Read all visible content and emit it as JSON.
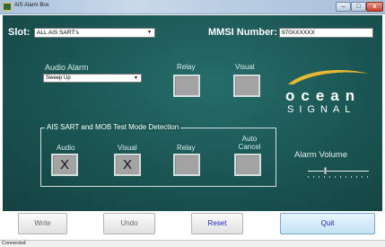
{
  "window": {
    "title": "AIS Alarm Box",
    "minimize_label": "–",
    "maximize_label": "□",
    "close_label": "x"
  },
  "header": {
    "slot_label": "Slot:",
    "slot_value": "ALL AIS SART's",
    "mmsi_label": "MMSI Number:",
    "mmsi_value": "970XXXXXX"
  },
  "alarm": {
    "audio_alarm_label": "Audio Alarm",
    "audio_alarm_value": "Sweep Up",
    "relay_label": "Relay",
    "visual_label": "Visual"
  },
  "logo": {
    "line1": "ocean",
    "line2": "SIGNAL",
    "accent_color": "#e8b832"
  },
  "test_mode": {
    "title": "AIS SART and MOB Test Mode Detection",
    "audio_label": "Audio",
    "audio_mark": "X",
    "visual_label": "Visual",
    "visual_mark": "X",
    "relay_label": "Relay",
    "auto_cancel_label_1": "Auto",
    "auto_cancel_label_2": "Cancel"
  },
  "volume": {
    "label": "Alarm Volume",
    "level_fraction": 0.3
  },
  "actions": {
    "write": "Write",
    "undo": "Undo",
    "reset": "Reset",
    "quit": "Quit"
  },
  "status": {
    "text": "Connected"
  }
}
